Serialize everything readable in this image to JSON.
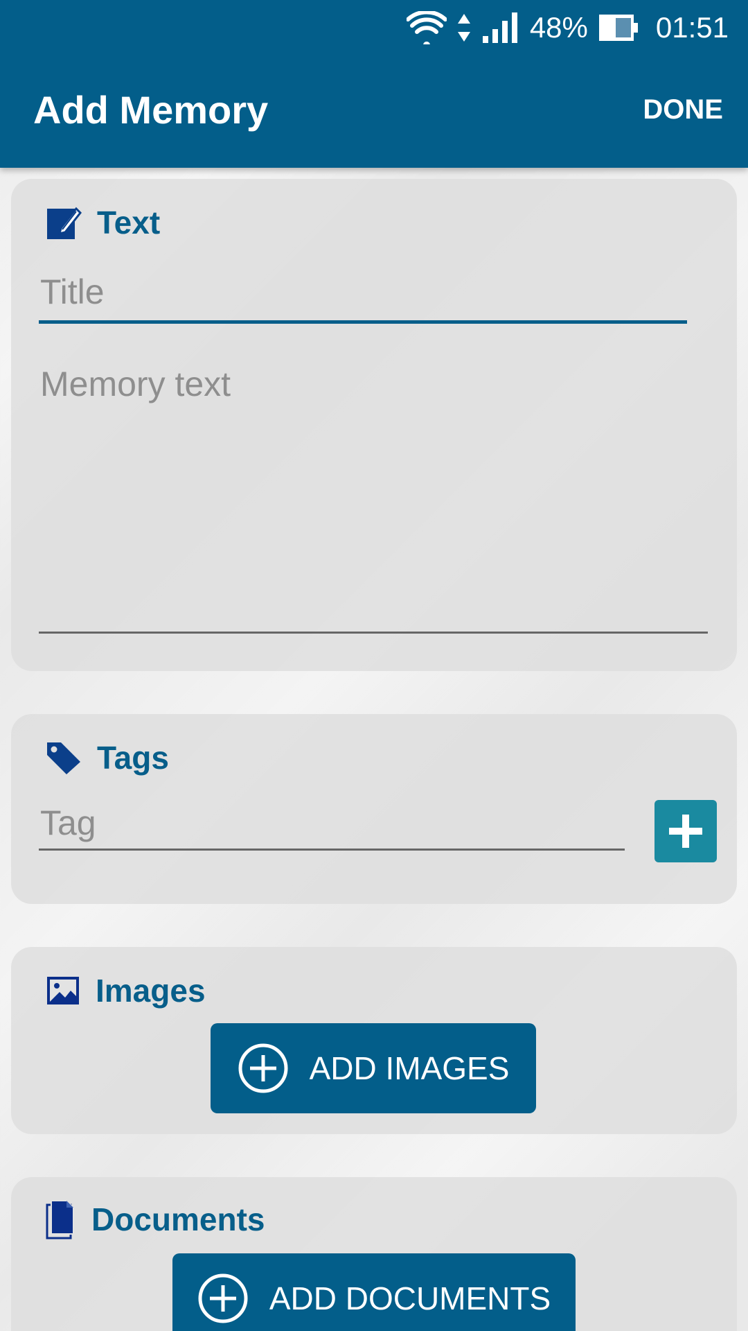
{
  "status_bar": {
    "battery_percent": "48%",
    "time": "01:51",
    "icons": [
      "wifi-icon",
      "data-arrows-icon",
      "signal-icon",
      "battery-icon"
    ]
  },
  "app_bar": {
    "title": "Add Memory",
    "done_label": "DONE"
  },
  "text_section": {
    "heading": "Text",
    "icon": "edit-icon",
    "title_placeholder": "Title",
    "title_value": "",
    "body_placeholder": "Memory text",
    "body_value": ""
  },
  "tags_section": {
    "heading": "Tags",
    "icon": "tag-icon",
    "tag_placeholder": "Tag",
    "tag_value": "",
    "add_icon": "plus-icon"
  },
  "images_section": {
    "heading": "Images",
    "icon": "image-icon",
    "button_label": "ADD IMAGES"
  },
  "documents_section": {
    "heading": "Documents",
    "icon": "documents-icon",
    "button_label": "ADD DOCUMENTS"
  },
  "colors": {
    "primary": "#035e8a",
    "accent": "#1a8aa0",
    "heading_text": "#075e8a",
    "placeholder": "#8e8e8e"
  }
}
